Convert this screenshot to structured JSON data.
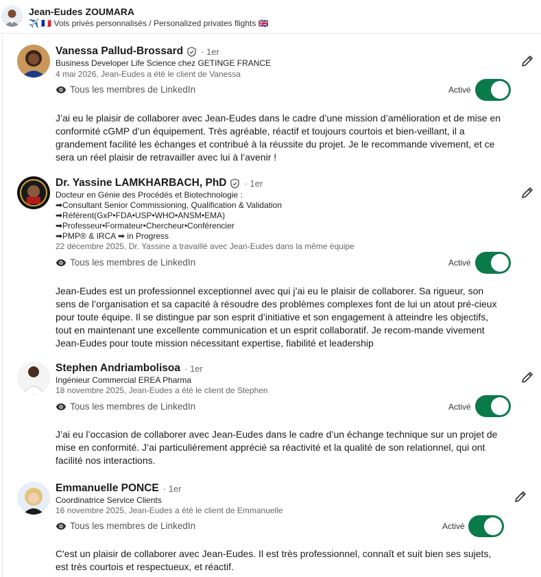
{
  "header": {
    "name": "Jean-Eudes ZOUMARA",
    "tagline": "✈️ 🇫🇷 Vols privés personnalisés / Personalized privates flights 🇬🇧"
  },
  "recommendations": [
    {
      "name": "Vanessa Pallud-Brossard",
      "degree": "· 1er",
      "headline": [
        "Business Developer Life Science chez GETINGE FRANCE"
      ],
      "meta": "4 mai 2026, Jean-Eudes a été le client de Vanessa",
      "visibility": "Tous les membres de LinkedIn",
      "status": "Activé",
      "text": "J’ai eu le plaisir de collaborer avec Jean-Eudes dans le cadre d’une mission d’amélioration et de mise en conformité cGMP d’un équipement. Très agréable, réactif et toujours courtois et bien-veillant, il a grandement facilité les échanges et contribué à la réussite du projet. Je le recommande vivement, et ce sera un réel plaisir de retravailler avec lui à l’avenir !"
    },
    {
      "name": "Dr. Yassine LAMKHARBACH, PhD",
      "degree": "· 1er",
      "headline": [
        "Docteur en Génie des Procédés et Biotechnologie :",
        "➡Consultant Senior Commissioning, Qualification & Validation",
        "➡Référent(GxP•FDA•USP•WHO•ANSM•EMA)",
        "➡Professeur•Formateur•Chercheur•Conférencier",
        "➡PMP® & IRCA ➡ in Progress"
      ],
      "meta": "22 décembre 2025, Dr. Yassine a travaillé avec Jean-Eudes dans la même équipe",
      "visibility": "Tous les membres de LinkedIn",
      "status": "Activé",
      "text": "Jean-Eudes est un professionnel exceptionnel avec qui j’ai eu le plaisir de collaborer. Sa rigueur, son sens de l’organisation et sa capacité à résoudre des problèmes complexes font de lui un atout pré-cieux pour toute équipe. Il se distingue par son esprit d’initiative et son engagement à atteindre les objectifs, tout en maintenant une excellente communication et un esprit collaboratif. Je recom-mande vivement Jean-Eudes pour toute mission nécessitant expertise, fiabilité et leadership"
    },
    {
      "name": "Stephen Andriambolisoa",
      "degree": "· 1er",
      "headline": [
        "Ingénieur Commercial EREA Pharma"
      ],
      "meta": "18 novembre 2025, Jean-Eudes a été le client de Stephen",
      "visibility": "Tous les membres de LinkedIn",
      "status": "Activé",
      "text": "J’ai eu l’occasion de collaborer avec Jean-Eudes dans le cadre d’un échange technique sur un projet de mise en conformité. J’ai particulièrement apprécié sa réactivité et la qualité de son relationnel, qui ont facilité nos interactions."
    },
    {
      "name": "Emmanuelle PONCE",
      "degree": "· 1er",
      "headline": [
        "Coordinatrice Service Clients"
      ],
      "meta": "16 novembre 2025, Jean-Eudes a été le client de Emmanuelle",
      "visibility": "Tous les membres de LinkedIn",
      "status": "Activé",
      "text": "C'est un plaisir de collaborer avec Jean-Eudes. Il est très professionnel, connaît et suit bien ses sujets, est très courtois et respectueux, et réactif."
    }
  ]
}
